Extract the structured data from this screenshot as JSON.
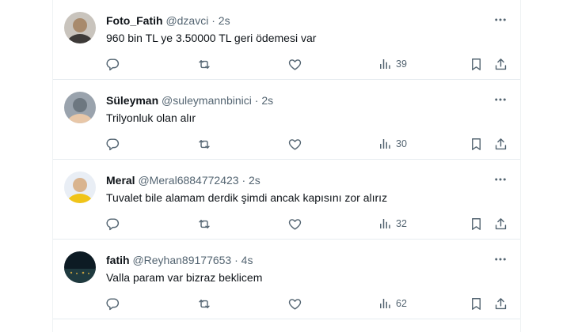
{
  "tweets": [
    {
      "name": "Foto_Fatih",
      "handle": "@dzavci",
      "separator": "·",
      "time": "2s",
      "text": "960 bin TL ye 3.50000 TL geri ödemesi var",
      "views": "39",
      "avatar_colors": [
        "#c9c4bd",
        "#3d3a38",
        "#a88a6c"
      ]
    },
    {
      "name": "Süleyman",
      "handle": "@suleymannbinici",
      "separator": "·",
      "time": "2s",
      "text": "Trilyonluk olan alır",
      "views": "30",
      "avatar_colors": [
        "#9aa3ad",
        "#e8c7a8",
        "#6d7780"
      ]
    },
    {
      "name": "Meral",
      "handle": "@Meral6884772423",
      "separator": "·",
      "time": "2s",
      "text": "Tuvalet bile alamam derdik şimdi ancak kapısını zor alırız",
      "views": "32",
      "avatar_colors": [
        "#e9eef5",
        "#f0c419",
        "#d9b48f"
      ]
    },
    {
      "name": "fatih",
      "handle": "@Reyhan89177653",
      "separator": "·",
      "time": "4s",
      "text": "Valla param var bizraz beklicem",
      "views": "62",
      "avatar_colors": [
        "#0d1b24",
        "#1f3a3f",
        "#c6a040"
      ]
    }
  ],
  "colors": {
    "icon": "#536471",
    "text": "#0f1419",
    "divider": "#e6ecf0"
  },
  "icons": {
    "more": "more-dots-icon",
    "reply": "reply-icon",
    "retweet": "retweet-icon",
    "like": "heart-icon",
    "views": "views-chart-icon",
    "bookmark": "bookmark-icon",
    "share": "share-icon"
  }
}
